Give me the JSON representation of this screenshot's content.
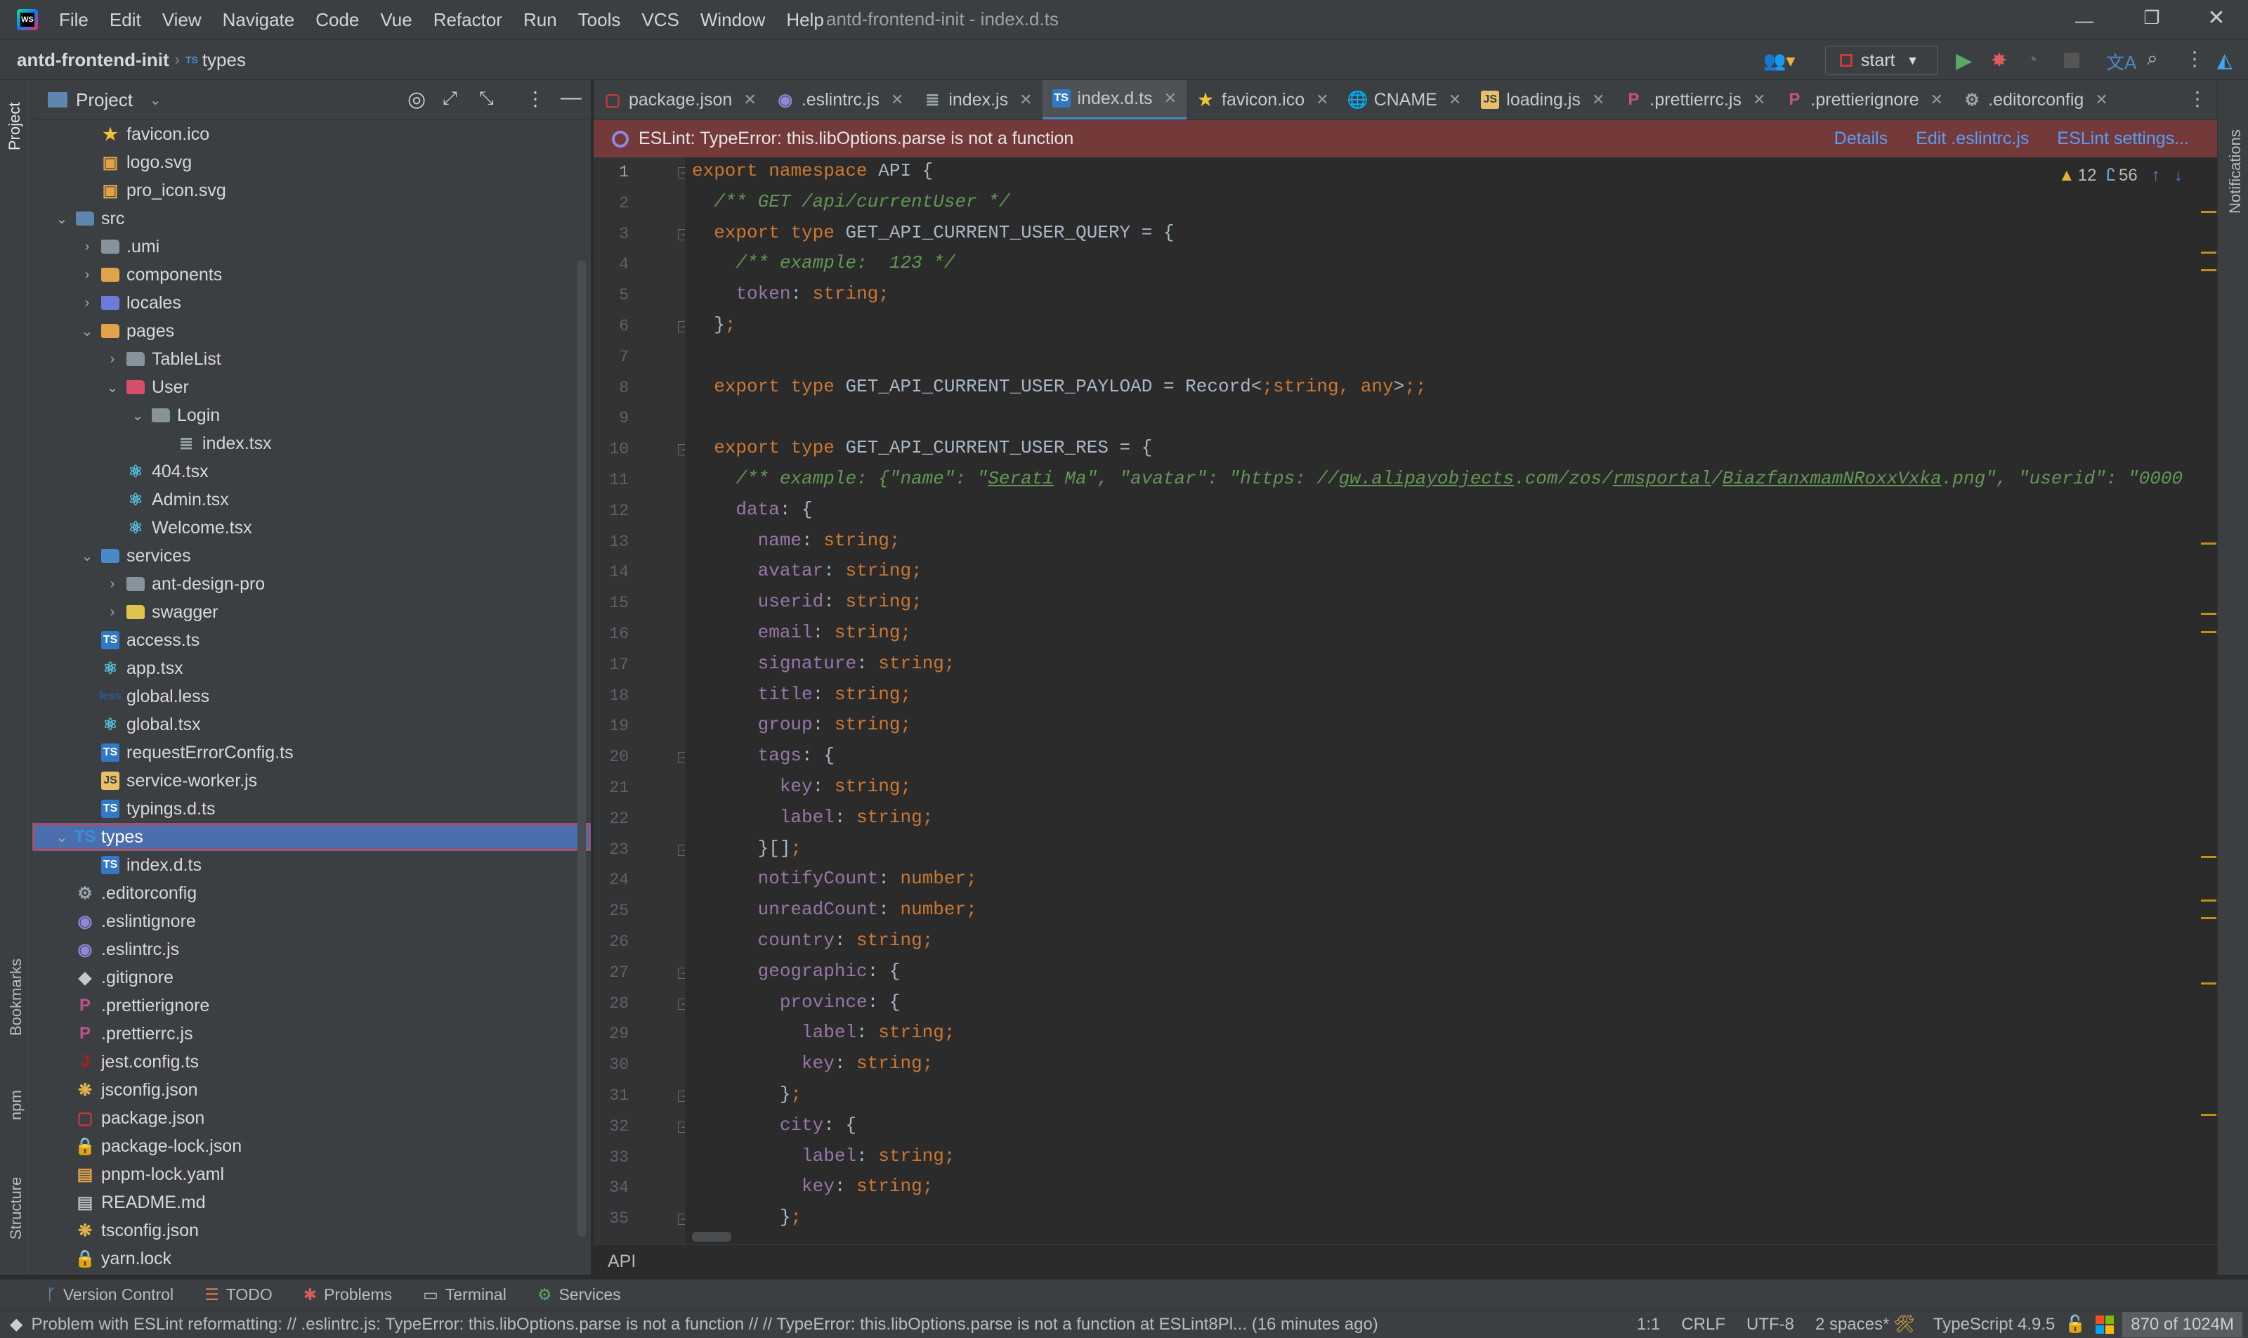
{
  "menubar": {
    "items": [
      "File",
      "Edit",
      "View",
      "Navigate",
      "Code",
      "Vue",
      "Refactor",
      "Run",
      "Tools",
      "VCS",
      "Window",
      "Help"
    ],
    "window_title": "antd-frontend-init - index.d.ts"
  },
  "navbar": {
    "project": "antd-frontend-init",
    "folder": "types",
    "run_config": "start"
  },
  "project_panel": {
    "title": "Project"
  },
  "tree": [
    {
      "label": "favicon.ico",
      "indent": 2,
      "icon": "star-icon"
    },
    {
      "label": "logo.svg",
      "indent": 2,
      "icon": "image-icon"
    },
    {
      "label": "pro_icon.svg",
      "indent": 2,
      "icon": "image-icon"
    },
    {
      "label": "src",
      "indent": 1,
      "icon": "source-folder-icon",
      "open": true
    },
    {
      "label": ".umi",
      "indent": 2,
      "icon": "folder-icon",
      "closed": true
    },
    {
      "label": "components",
      "indent": 2,
      "icon": "folder-icon",
      "closed": true
    },
    {
      "label": "locales",
      "indent": 2,
      "icon": "folder-icon",
      "closed": true
    },
    {
      "label": "pages",
      "indent": 2,
      "icon": "folder-icon",
      "open": true
    },
    {
      "label": "TableList",
      "indent": 3,
      "icon": "folder-icon",
      "closed": true
    },
    {
      "label": "User",
      "indent": 3,
      "icon": "folder-icon",
      "open": true
    },
    {
      "label": "Login",
      "indent": 4,
      "icon": "folder-icon",
      "open": true
    },
    {
      "label": "index.tsx",
      "indent": 5,
      "icon": "file-icon"
    },
    {
      "label": "404.tsx",
      "indent": 3,
      "icon": "react-icon"
    },
    {
      "label": "Admin.tsx",
      "indent": 3,
      "icon": "react-icon"
    },
    {
      "label": "Welcome.tsx",
      "indent": 3,
      "icon": "react-icon"
    },
    {
      "label": "services",
      "indent": 2,
      "icon": "folder-icon",
      "open": true
    },
    {
      "label": "ant-design-pro",
      "indent": 3,
      "icon": "folder-icon",
      "closed": true
    },
    {
      "label": "swagger",
      "indent": 3,
      "icon": "folder-icon",
      "closed": true
    },
    {
      "label": "access.ts",
      "indent": 2,
      "icon": "ts-icon"
    },
    {
      "label": "app.tsx",
      "indent": 2,
      "icon": "react-icon"
    },
    {
      "label": "global.less",
      "indent": 2,
      "icon": "less-icon"
    },
    {
      "label": "global.tsx",
      "indent": 2,
      "icon": "react-icon"
    },
    {
      "label": "requestErrorConfig.ts",
      "indent": 2,
      "icon": "ts-icon"
    },
    {
      "label": "service-worker.js",
      "indent": 2,
      "icon": "js-icon"
    },
    {
      "label": "typings.d.ts",
      "indent": 2,
      "icon": "ts-icon"
    },
    {
      "label": "types",
      "indent": 1,
      "icon": "ts-folder-icon",
      "open": true,
      "selected": true
    },
    {
      "label": "index.d.ts",
      "indent": 2,
      "icon": "ts-icon"
    },
    {
      "label": ".editorconfig",
      "indent": 1,
      "icon": "gear-icon"
    },
    {
      "label": ".eslintignore",
      "indent": 1,
      "icon": "eslint-icon"
    },
    {
      "label": ".eslintrc.js",
      "indent": 1,
      "icon": "eslint-icon"
    },
    {
      "label": ".gitignore",
      "indent": 1,
      "icon": "git-icon"
    },
    {
      "label": ".prettierignore",
      "indent": 1,
      "icon": "prettier-icon"
    },
    {
      "label": ".prettierrc.js",
      "indent": 1,
      "icon": "prettier-icon"
    },
    {
      "label": "jest.config.ts",
      "indent": 1,
      "icon": "jest-icon"
    },
    {
      "label": "jsconfig.json",
      "indent": 1,
      "icon": "json-icon"
    },
    {
      "label": "package.json",
      "indent": 1,
      "icon": "npm-icon"
    },
    {
      "label": "package-lock.json",
      "indent": 1,
      "icon": "lock-icon"
    },
    {
      "label": "pnpm-lock.yaml",
      "indent": 1,
      "icon": "yaml-icon"
    },
    {
      "label": "README.md",
      "indent": 1,
      "icon": "md-icon"
    },
    {
      "label": "tsconfig.json",
      "indent": 1,
      "icon": "json-icon"
    },
    {
      "label": "yarn.lock",
      "indent": 1,
      "icon": "lock-icon"
    }
  ],
  "tabs": [
    {
      "label": "package.json",
      "icon": "npm-icon"
    },
    {
      "label": ".eslintrc.js",
      "icon": "eslint-icon"
    },
    {
      "label": "index.js",
      "icon": "file-icon"
    },
    {
      "label": "index.d.ts",
      "icon": "ts-icon",
      "active": true
    },
    {
      "label": "favicon.ico",
      "icon": "star-icon"
    },
    {
      "label": "CNAME",
      "icon": "globe-icon"
    },
    {
      "label": "loading.js",
      "icon": "js-icon"
    },
    {
      "label": ".prettierrc.js",
      "icon": "prettier-icon"
    },
    {
      "label": ".prettierignore",
      "icon": "prettier-icon"
    },
    {
      "label": ".editorconfig",
      "icon": "gear-icon"
    }
  ],
  "banner": {
    "message": "ESLint: TypeError: this.libOptions.parse is not a function",
    "details": "Details",
    "edit": "Edit .eslintrc.js",
    "settings": "ESLint settings..."
  },
  "inspections": {
    "warnings": "12",
    "typos": "56"
  },
  "code_lines": [
    "export namespace API {",
    "  /** GET /api/currentUser */",
    "  export type GET_API_CURRENT_USER_QUERY = {",
    "    /** example:  123 */",
    "    token: string;",
    "  };",
    "",
    "  export type GET_API_CURRENT_USER_PAYLOAD = Record<string, any>;",
    "",
    "  export type GET_API_CURRENT_USER_RES = {",
    "    /** example: {\"name\": \"Serati Ma\", \"avatar\": \"https: //gw.alipayobjects.com/zos/rmsportal/BiazfanxmamNRoxxVxka.png\", \"userid\": \"0000",
    "    data: {",
    "      name: string;",
    "      avatar: string;",
    "      userid: string;",
    "      email: string;",
    "      signature: string;",
    "      title: string;",
    "      group: string;",
    "      tags: {",
    "        key: string;",
    "        label: string;",
    "      }[];",
    "      notifyCount: number;",
    "      unreadCount: number;",
    "      country: string;",
    "      geographic: {",
    "        province: {",
    "          label: string;",
    "          key: string;",
    "        };",
    "        city: {",
    "          label: string;",
    "          key: string;",
    "        };"
  ],
  "editor_breadcrumb": "API",
  "toolwindows": [
    "Version Control",
    "TODO",
    "Problems",
    "Terminal",
    "Services"
  ],
  "side_tabs": {
    "project": "Project",
    "bookmarks": "Bookmarks",
    "npm": "npm",
    "structure": "Structure",
    "notifications": "Notifications"
  },
  "status": {
    "message": "Problem with ESLint reformatting: // .eslintrc.js: TypeError: this.libOptions.parse is not a function // // TypeError: this.libOptions.parse is not a function    at ESLint8Pl... (16 minutes ago)",
    "position": "1:1",
    "line_sep": "CRLF",
    "encoding": "UTF-8",
    "indent": "2 spaces*",
    "language": "TypeScript 4.9.5",
    "memory": "870 of 1024M"
  }
}
